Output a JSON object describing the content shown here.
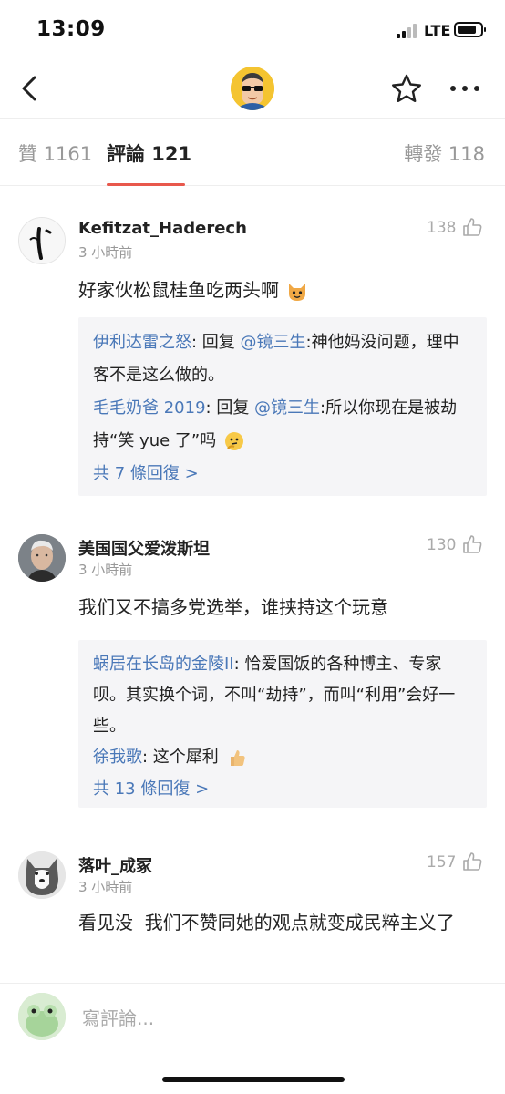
{
  "status_bar": {
    "time": "13:09",
    "network": "LTE"
  },
  "tabs": {
    "likes": "贊 1161",
    "comments": "評論 121",
    "reposts": "轉發 118"
  },
  "comments": [
    {
      "name": "Kefitzat_Haderech",
      "time": "3 小時前",
      "likes": "138",
      "body": "好家伙松鼠桂鱼吃两头啊",
      "replies": [
        {
          "name": "伊利达雷之怒",
          "sep": ": 回复 ",
          "mention": "@镜三生",
          "text": ":神他妈没问题，理中客不是这么做的。"
        },
        {
          "name": "毛毛奶爸 2019",
          "sep": ": 回复 ",
          "mention": "@镜三生",
          "text": ":所以你现在是被劫持“笑 yue 了”吗"
        }
      ],
      "more": "共 7 條回復 >"
    },
    {
      "name": "美国国父爱泼斯坦",
      "time": "3 小時前",
      "likes": "130",
      "body": "我们又不搞多党选举，谁挟持这个玩意",
      "replies": [
        {
          "name": "蜗居在长岛的金陵II",
          "sep": ": ",
          "mention": "",
          "text": "恰爱国饭的各种博主、专家呗。其实换个词，不叫“劫持”，而叫“利用”会好一些。"
        },
        {
          "name": "徐我歌",
          "sep": ": ",
          "mention": "",
          "text": "这个犀利"
        }
      ],
      "more": "共 13 條回復 >"
    },
    {
      "name": "落叶_成冢",
      "time": "3 小時前",
      "likes": "157",
      "body": "看见没  我们不赞同她的观点就变成民粹主义了"
    }
  ],
  "composer": {
    "placeholder": "寫評論..."
  },
  "colors": {
    "accent": "#e8584c",
    "link": "#4a78b8"
  }
}
